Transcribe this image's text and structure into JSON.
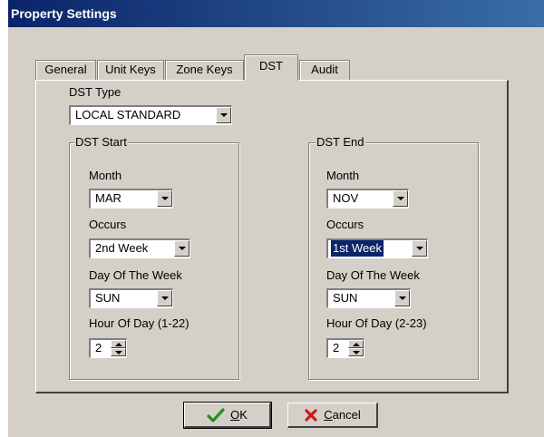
{
  "window": {
    "title": "Property Settings"
  },
  "tabs": [
    {
      "label": "General",
      "active": false
    },
    {
      "label": "Unit Keys",
      "active": false
    },
    {
      "label": "Zone Keys",
      "active": false
    },
    {
      "label": "DST",
      "active": true
    },
    {
      "label": "Audit",
      "active": false
    }
  ],
  "dst_type": {
    "label": "DST Type",
    "value": "LOCAL STANDARD"
  },
  "dst_start": {
    "title": "DST Start",
    "month_label": "Month",
    "month_value": "MAR",
    "occurs_label": "Occurs",
    "occurs_value": "2nd Week",
    "day_label": "Day Of The Week",
    "day_value": "SUN",
    "hour_label": "Hour Of Day (1-22)",
    "hour_value": "2"
  },
  "dst_end": {
    "title": "DST End",
    "month_label": "Month",
    "month_value": "NOV",
    "occurs_label": "Occurs",
    "occurs_value": "1st Week",
    "day_label": "Day Of The Week",
    "day_value": "SUN",
    "hour_label": "Hour Of Day (2-23)",
    "hour_value": "2"
  },
  "buttons": {
    "ok_label": "OK",
    "cancel_label": "Cancel"
  },
  "colors": {
    "title_bar_start": "#0a246a",
    "title_bar_end": "#3a6ea5",
    "dialog_background": "#d4d0c8",
    "selection": "#0a246a",
    "ok_check": "#2e8b22",
    "cancel_x": "#cc1a1a"
  },
  "icons": {
    "ok": "checkmark-icon",
    "cancel": "x-icon"
  }
}
